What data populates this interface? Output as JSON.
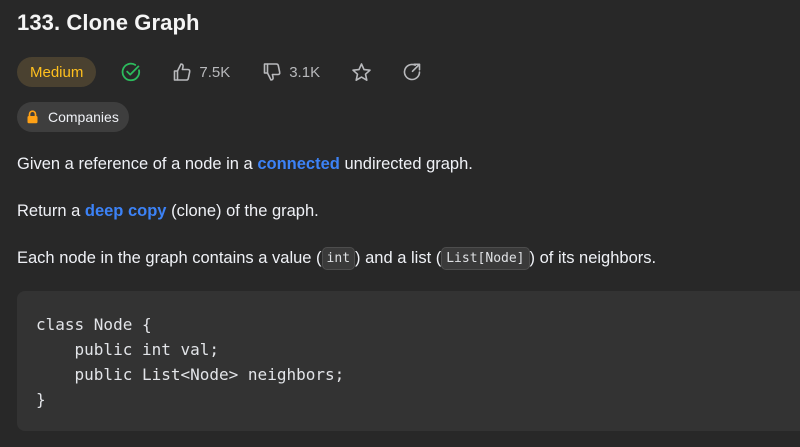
{
  "problem": {
    "title": "133. Clone Graph",
    "difficulty": "Medium",
    "likes": "7.5K",
    "dislikes": "3.1K",
    "companies_label": "Companies"
  },
  "icons": {
    "solved": "check-circle-icon",
    "like": "thumbs-up-icon",
    "dislike": "thumbs-down-icon",
    "favorite": "star-icon",
    "share": "share-icon",
    "companies": "lock-icon"
  },
  "description": {
    "p1": {
      "before": "Given a reference of a node in a ",
      "link": "connected",
      "after": " undirected graph."
    },
    "p2": {
      "before": "Return a ",
      "link": "deep copy",
      "after": " (clone) of the graph."
    },
    "p3": {
      "before": "Each node in the graph contains a value (",
      "code1": "int",
      "middle": ") and a list (",
      "code2": "List[Node]",
      "after": ") of its neighbors."
    }
  },
  "code_block": "class Node {\n    public int val;\n    public List<Node> neighbors;\n}",
  "colors": {
    "background": "#282828",
    "difficulty_medium": "#ffc01e",
    "link": "#3c82f6",
    "solved_check": "#2cbb5d",
    "lock": "#ffa116"
  }
}
